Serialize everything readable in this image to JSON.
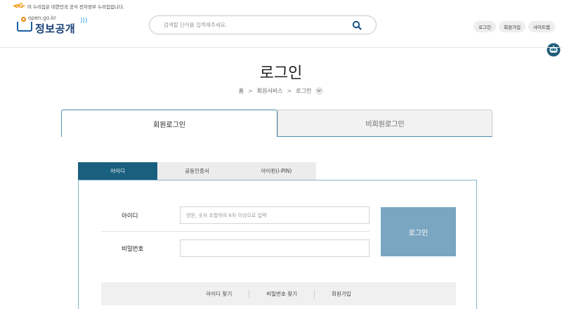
{
  "gov_banner": {
    "mark": "-eG-",
    "text": "이 누리집은 대한민국 공식 전자정부 누리집입니다."
  },
  "header": {
    "logo_domain": "open.go.kr",
    "logo_name": "정보공개",
    "search_placeholder": "검색할 단어를 입력해주세요.",
    "search_icon": "search-icon",
    "links": [
      "로그인",
      "회원가입",
      "사이트맵"
    ],
    "chatbot_icon": "robot-icon"
  },
  "page": {
    "title": "로그인",
    "breadcrumb": [
      "홈",
      "회원서비스",
      "로그인"
    ]
  },
  "main_tabs": {
    "member": "회원로그인",
    "guest": "비회원로그인"
  },
  "sub_tabs": [
    "아이디",
    "공동인증서",
    "아이핀(i-PIN)"
  ],
  "form": {
    "id_label": "아이디",
    "id_placeholder": "영문, 숫자 조합하여 6자 이상으로 입력",
    "pw_label": "비밀번호",
    "pw_value": "",
    "login_button": "로그인"
  },
  "helper_links": [
    "아이디 찾기",
    "비밀번호 찾기",
    "회원가입"
  ],
  "colors": {
    "accent": "#195f7e",
    "login_button": "#7ba6c1",
    "logo_blue": "#1a3f78",
    "banner_orange": "#f39200"
  }
}
